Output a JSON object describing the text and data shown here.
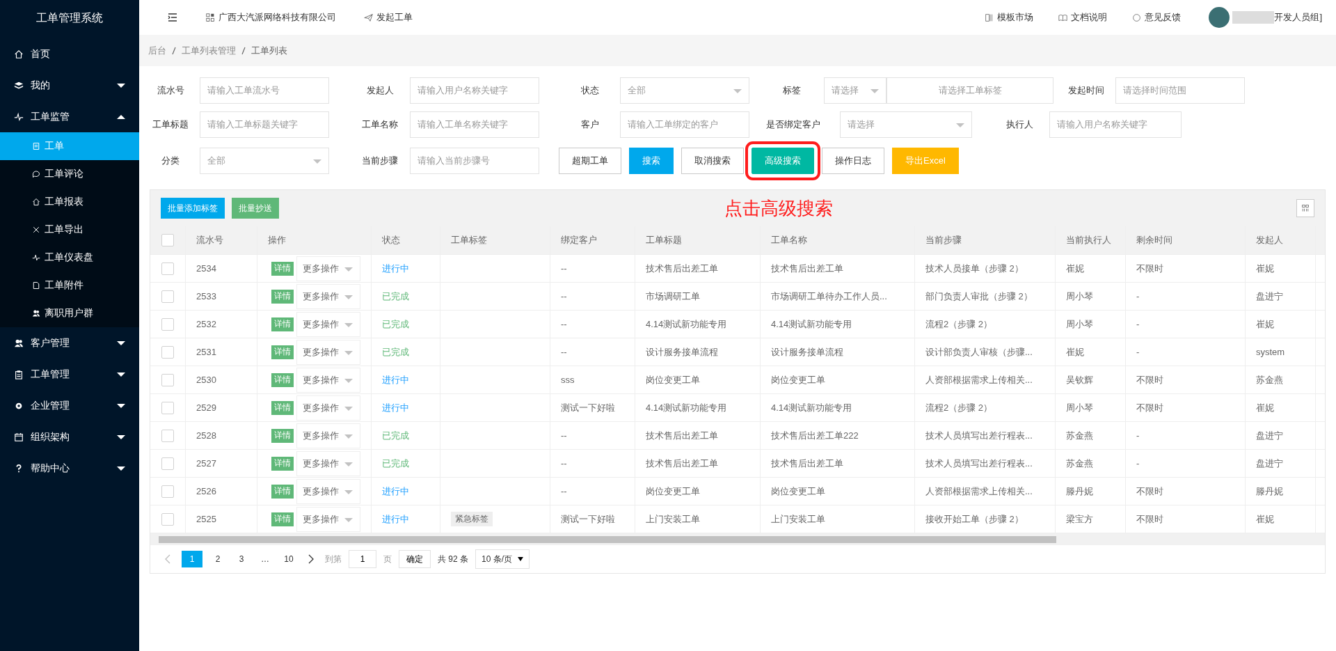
{
  "app_title": "工单管理系统",
  "sidebar": {
    "items": [
      {
        "label": "首页",
        "selected": false
      },
      {
        "label": "我的",
        "expanded": false,
        "selected": false
      },
      {
        "label": "工单监管",
        "expanded": true,
        "selected": false,
        "children": [
          {
            "label": "工单",
            "selected": true
          },
          {
            "label": "工单评论",
            "selected": false
          },
          {
            "label": "工单报表",
            "selected": false
          },
          {
            "label": "工单导出",
            "selected": false
          },
          {
            "label": "工单仪表盘",
            "selected": false
          },
          {
            "label": "工单附件",
            "selected": false
          },
          {
            "label": "离职用户群",
            "selected": false
          }
        ]
      },
      {
        "label": "客户管理",
        "expanded": false,
        "selected": false
      },
      {
        "label": "工单管理",
        "expanded": false,
        "selected": false
      },
      {
        "label": "企业管理",
        "expanded": false,
        "selected": false
      },
      {
        "label": "组织架构",
        "expanded": false,
        "selected": false
      },
      {
        "label": "帮助中心",
        "expanded": false,
        "selected": false
      }
    ]
  },
  "topbar": {
    "company": "广西大汽派网络科技有限公司",
    "start_order": "发起工单",
    "links": [
      "模板市场",
      "文档说明",
      "意见反馈"
    ],
    "user": "开发人员组]"
  },
  "breadcrumb": [
    "后台",
    "工单列表管理",
    "工单列表"
  ],
  "filters": [
    [
      {
        "label": "流水号",
        "kind": "input",
        "placeholder": "请输入工单流水号"
      },
      {
        "label": "发起人",
        "kind": "input",
        "placeholder": "请输入用户名称关键字"
      },
      {
        "label": "状态",
        "kind": "select",
        "value": "全部"
      },
      {
        "label": "标签",
        "kind": "tag",
        "value": "请选择",
        "placeholder": "请选择工单标签"
      },
      {
        "label": "发起时间",
        "kind": "input",
        "placeholder": "请选择时间范围"
      }
    ],
    [
      {
        "label": "工单标题",
        "kind": "input",
        "placeholder": "请输入工单标题关键字"
      },
      {
        "label": "工单名称",
        "kind": "input",
        "placeholder": "请输入工单名称关键字"
      },
      {
        "label": "客户",
        "kind": "input",
        "placeholder": "请输入工单绑定的客户"
      },
      {
        "label": "是否绑定客户",
        "kind": "select",
        "value": "请选择"
      },
      {
        "label": "执行人",
        "kind": "input",
        "placeholder": "请输入用户名称关键字"
      }
    ],
    [
      {
        "label": "分类",
        "kind": "select",
        "value": "全部"
      },
      {
        "label": "当前步骤",
        "kind": "input",
        "placeholder": "请输入当前步骤号"
      }
    ]
  ],
  "buttons": [
    {
      "label": "超期工单",
      "kind": "plain",
      "highlighted": false
    },
    {
      "label": "搜索",
      "kind": "blue",
      "highlighted": false
    },
    {
      "label": "取消搜索",
      "kind": "plain",
      "highlighted": false
    },
    {
      "label": "高级搜索",
      "kind": "teal",
      "highlighted": true
    },
    {
      "label": "操作日志",
      "kind": "plain",
      "highlighted": false
    },
    {
      "label": "导出Excel",
      "kind": "amber",
      "highlighted": false
    }
  ],
  "bulk_buttons": [
    {
      "label": "批量添加标签",
      "kind": "blue"
    },
    {
      "label": "批量抄送",
      "kind": "green"
    }
  ],
  "annotation": "点击高级搜索",
  "table": {
    "select_all_checked": false,
    "columns": [
      "流水号",
      "操作",
      "状态",
      "工单标签",
      "绑定客户",
      "工单标题",
      "工单名称",
      "当前步骤",
      "当前执行人",
      "剩余时间",
      "发起人"
    ],
    "rows": [
      {
        "checked": false,
        "id": "2534",
        "detail": "详情",
        "more": "更多操作",
        "status": "进行中",
        "kind": "progress",
        "tag": "",
        "customer": "--",
        "title": "技术售后出差工单",
        "name": "技术售后出差工单",
        "step": "技术人员接单（步骤 2）",
        "executor": "崔妮",
        "remaining": "不限时",
        "initiator": "崔妮"
      },
      {
        "checked": false,
        "id": "2533",
        "detail": "详情",
        "more": "更多操作",
        "status": "已完成",
        "kind": "done",
        "tag": "",
        "customer": "--",
        "title": "市场调研工单",
        "name": "市场调研工单待办工作人员...",
        "step": "部门负责人审批（步骤 2）",
        "executor": "周小琴",
        "remaining": "-",
        "initiator": "盘进宁"
      },
      {
        "checked": false,
        "id": "2532",
        "detail": "详情",
        "more": "更多操作",
        "status": "已完成",
        "kind": "done",
        "tag": "",
        "customer": "--",
        "title": "4.14测试新功能专用",
        "name": "4.14测试新功能专用",
        "step": "流程2（步骤 2）",
        "executor": "周小琴",
        "remaining": "-",
        "initiator": "崔妮"
      },
      {
        "checked": false,
        "id": "2531",
        "detail": "详情",
        "more": "更多操作",
        "status": "已完成",
        "kind": "done",
        "tag": "",
        "customer": "--",
        "title": "设计服务接单流程",
        "name": "设计服务接单流程",
        "step": "设计部负责人审核（步骤...",
        "executor": "崔妮",
        "remaining": "-",
        "initiator": "system"
      },
      {
        "checked": false,
        "id": "2530",
        "detail": "详情",
        "more": "更多操作",
        "status": "进行中",
        "kind": "progress",
        "tag": "",
        "customer": "sss",
        "title": "岗位变更工单",
        "name": "岗位变更工单",
        "step": "人资部根据需求上传相关...",
        "executor": "吴钦辉",
        "remaining": "不限时",
        "initiator": "苏金燕"
      },
      {
        "checked": false,
        "id": "2529",
        "detail": "详情",
        "more": "更多操作",
        "status": "进行中",
        "kind": "progress",
        "tag": "",
        "customer": "测试一下好啦",
        "title": "4.14测试新功能专用",
        "name": "4.14测试新功能专用",
        "step": "流程2（步骤 2）",
        "executor": "周小琴",
        "remaining": "不限时",
        "initiator": "崔妮"
      },
      {
        "checked": false,
        "id": "2528",
        "detail": "详情",
        "more": "更多操作",
        "status": "已完成",
        "kind": "done",
        "tag": "",
        "customer": "--",
        "title": "技术售后出差工单",
        "name": "技术售后出差工单222",
        "step": "技术人员填写出差行程表...",
        "executor": "苏金燕",
        "remaining": "-",
        "initiator": "盘进宁"
      },
      {
        "checked": false,
        "id": "2527",
        "detail": "详情",
        "more": "更多操作",
        "status": "已完成",
        "kind": "done",
        "tag": "",
        "customer": "--",
        "title": "技术售后出差工单",
        "name": "技术售后出差工单",
        "step": "技术人员填写出差行程表...",
        "executor": "苏金燕",
        "remaining": "-",
        "initiator": "盘进宁"
      },
      {
        "checked": false,
        "id": "2526",
        "detail": "详情",
        "more": "更多操作",
        "status": "进行中",
        "kind": "progress",
        "tag": "",
        "customer": "--",
        "title": "岗位变更工单",
        "name": "岗位变更工单",
        "step": "人资部根据需求上传相关...",
        "executor": "滕丹妮",
        "remaining": "不限时",
        "initiator": "滕丹妮"
      },
      {
        "checked": false,
        "id": "2525",
        "detail": "详情",
        "more": "更多操作",
        "status": "进行中",
        "kind": "progress",
        "tag": "紧急标签",
        "customer": "测试一下好啦",
        "title": "上门安装工单",
        "name": "上门安装工单",
        "step": "接收开始工单（步骤 2）",
        "executor": "梁宝方",
        "remaining": "不限时",
        "initiator": "崔妮"
      }
    ]
  },
  "pagination": {
    "pages": [
      {
        "label": "1",
        "selected": true
      },
      {
        "label": "2",
        "selected": false
      },
      {
        "label": "3",
        "selected": false
      },
      {
        "label": "…",
        "selected": false
      },
      {
        "label": "10",
        "selected": false
      }
    ],
    "goto_label": "到第",
    "goto_value": "1",
    "page_unit": "页",
    "confirm": "确定",
    "total": "共 92 条",
    "page_size": "10 条/页"
  }
}
